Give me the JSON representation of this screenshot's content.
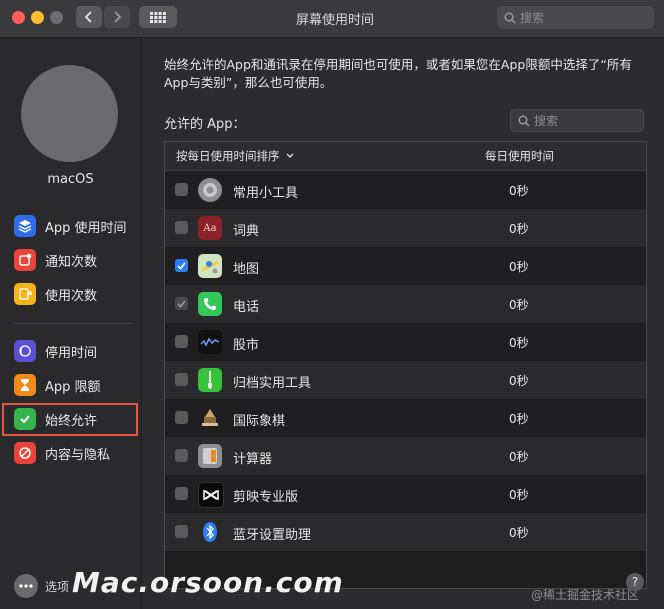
{
  "window": {
    "title": "屏幕使用时间"
  },
  "toolbar": {
    "search_placeholder": "搜索"
  },
  "sidebar": {
    "username": "macOS",
    "items": [
      {
        "label": "App 使用时间",
        "icon": "layers-icon",
        "color": "#2f6ee8"
      },
      {
        "label": "通知次数",
        "icon": "notification-icon",
        "color": "#e8443a"
      },
      {
        "label": "使用次数",
        "icon": "pickup-arrow-icon",
        "color": "#f2b418"
      },
      {
        "label": "停用时间",
        "icon": "downtime-moon-icon",
        "color": "#5a4fd6"
      },
      {
        "label": "App 限额",
        "icon": "hourglass-icon",
        "color": "#f08a1c"
      },
      {
        "label": "始终允许",
        "icon": "checkmark-badge-icon",
        "color": "#36b34a"
      },
      {
        "label": "内容与隐私",
        "icon": "no-entry-icon",
        "color": "#e8443a"
      }
    ],
    "options_label": "选项"
  },
  "main": {
    "description": "始终允许的App和通讯录在停用期间也可使用，或者如果您在App限额中选择了“所有App与类别”，那么也可使用。",
    "allowed_label": "允许的 App：",
    "search_placeholder": "搜索",
    "table": {
      "col_name": "按每日使用时间排序",
      "col_time": "每日使用时间",
      "rows": [
        {
          "name": "常用小工具",
          "time": "0秒",
          "checked": false,
          "icon": "widgets-icon"
        },
        {
          "name": "词典",
          "time": "0秒",
          "checked": false,
          "icon": "dictionary-icon"
        },
        {
          "name": "地图",
          "time": "0秒",
          "checked": true,
          "icon": "maps-icon"
        },
        {
          "name": "电话",
          "time": "0秒",
          "checked": true,
          "icon": "phone-icon"
        },
        {
          "name": "股市",
          "time": "0秒",
          "checked": false,
          "icon": "stocks-icon"
        },
        {
          "name": "归档实用工具",
          "time": "0秒",
          "checked": false,
          "icon": "archive-icon"
        },
        {
          "name": "国际象棋",
          "time": "0秒",
          "checked": false,
          "icon": "chess-icon"
        },
        {
          "name": "计算器",
          "time": "0秒",
          "checked": false,
          "icon": "calculator-icon"
        },
        {
          "name": "剪映专业版",
          "time": "0秒",
          "checked": false,
          "icon": "capcut-icon"
        },
        {
          "name": "蓝牙设置助理",
          "time": "0秒",
          "checked": false,
          "icon": "bluetooth-icon"
        }
      ]
    }
  },
  "overlay": {
    "watermark": "Mac.orsoon.com",
    "credit": "@稀土掘金技术社区",
    "help": "?"
  }
}
